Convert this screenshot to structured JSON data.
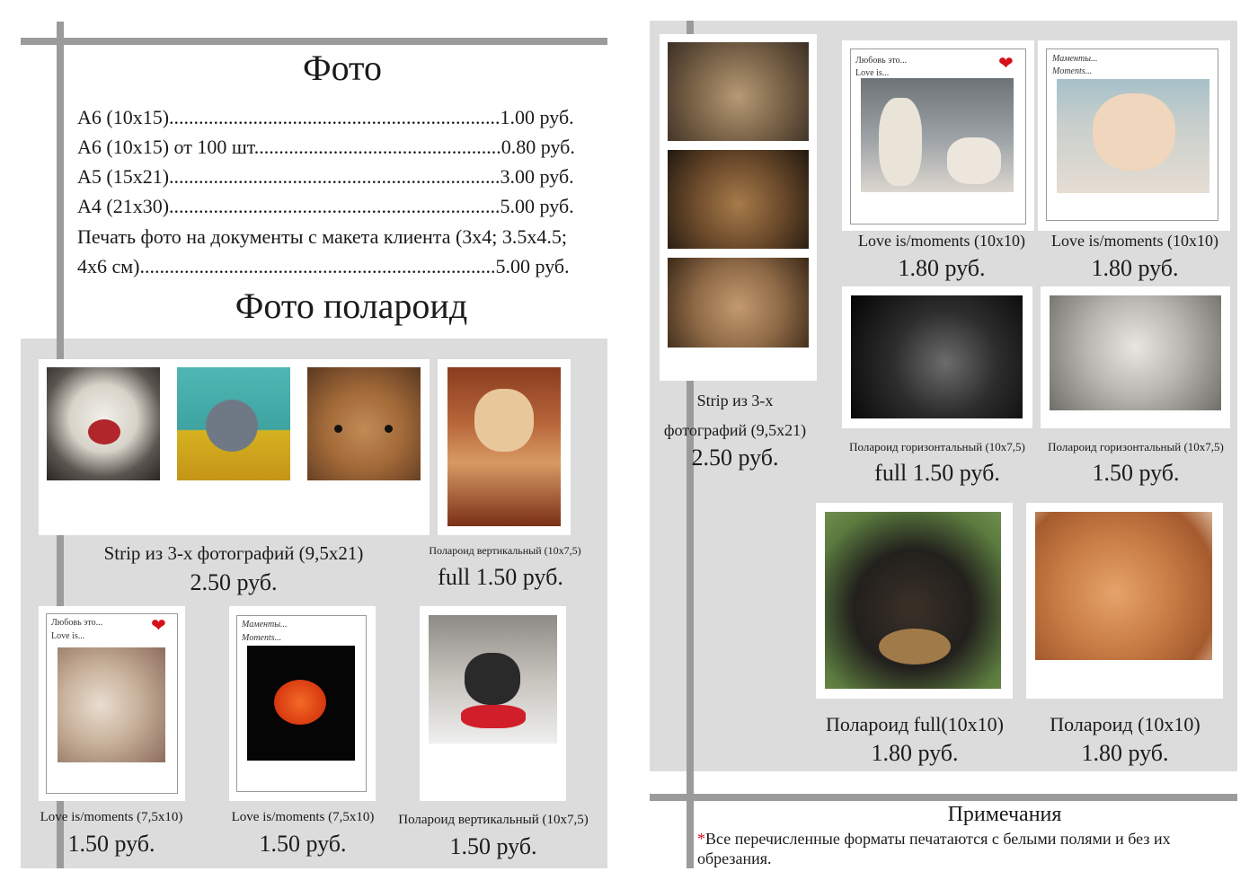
{
  "photo_section": {
    "title": "Фото",
    "price_lines": [
      "А6 (10х15)...................................................................1.00 руб.",
      "А6 (10х15) от 100 шт..................................................0.80 руб.",
      "А5 (15х21)...................................................................3.00 руб.",
      "А4 (21х30)...................................................................5.00 руб.",
      "Печать фото на документы с макета клиента (3х4; 3.5х4.5;",
      "4х6 см)........................................................................5.00 руб."
    ]
  },
  "polaroid_section": {
    "title": "Фото полароид",
    "left_products": [
      {
        "caption": "Strip из 3-х фотографий (9,5х21)",
        "price": "2.50 руб."
      },
      {
        "caption": "Полароид вертикальный (10х7,5)",
        "price": "full 1.50 руб."
      },
      {
        "caption": "Love is/moments (7,5x10)",
        "price": "1.50 руб.",
        "card_text": [
          "Любовь это...",
          "Love is..."
        ]
      },
      {
        "caption": "Love is/moments (7,5x10)",
        "price": "1.50 руб.",
        "card_text": [
          "Маменты...",
          "Moments..."
        ]
      },
      {
        "caption": "Полароид вертикальный (10х7,5)",
        "price": "1.50 руб."
      }
    ],
    "right_products": [
      {
        "caption_lines": [
          "Strip из 3-х",
          "фотографий (9,5х21)"
        ],
        "price": "2.50 руб."
      },
      {
        "caption": "Love is/moments (10x10)",
        "price": "1.80 руб.",
        "card_text": [
          "Любовь это...",
          "Love is..."
        ]
      },
      {
        "caption": "Love is/moments (10x10)",
        "price": "1.80 руб.",
        "card_text": [
          "Маменты...",
          "Moments..."
        ]
      },
      {
        "caption": "Полароид горизонтальный (10х7,5)",
        "price": "full 1.50 руб."
      },
      {
        "caption": "Полароид горизонтальный (10х7,5)",
        "price": "1.50 руб."
      },
      {
        "caption": "Полароид full(10x10)",
        "price": "1.80 руб."
      },
      {
        "caption": "Полароид (10x10)",
        "price": "1.80 руб."
      }
    ]
  },
  "notes": {
    "title": "Примечания",
    "asterisk": "*",
    "text": "Все перечисленные форматы печатаются с белыми полями и без их обрезания."
  },
  "colors": {
    "accent_heart": "#d4111a",
    "panel": "#dcdcdc",
    "bar": "#9b9b9b"
  }
}
